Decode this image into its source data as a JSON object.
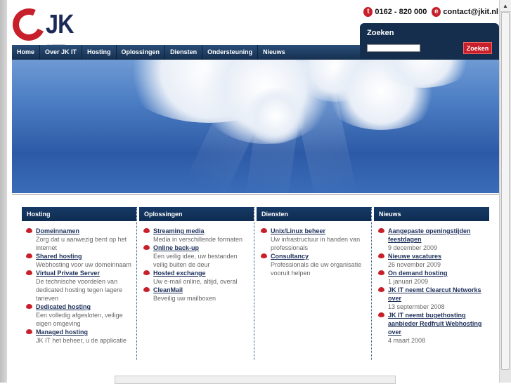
{
  "header": {
    "logo_text": "JK IT",
    "phone_icon": "t",
    "phone": "0162 - 820 000",
    "email_icon": "e",
    "email": "contact@jkit.nl"
  },
  "search": {
    "label": "Zoeken",
    "placeholder": "",
    "button": "Zoeken"
  },
  "nav": [
    "Home",
    "Over JK IT",
    "Hosting",
    "Oplossingen",
    "Diensten",
    "Ondersteuning",
    "Nieuws"
  ],
  "columns": [
    {
      "title": "Hosting",
      "items": [
        {
          "link": "Domeinnamen",
          "text": "Zorg dat u aanwezig bent op het internet"
        },
        {
          "link": "Shared hosting",
          "text": "Webhosting voor uw domeinnaam"
        },
        {
          "link": "Virtual Private Server",
          "text": "De technische voordelen van dedicated hosting tegen lagere tarieven"
        },
        {
          "link": "Dedicated hosting",
          "text": "Een volledig afgesloten, veilige eigen omgeving"
        },
        {
          "link": "Managed hosting",
          "text": "JK IT het beheer, u de applicatie"
        }
      ]
    },
    {
      "title": "Oplossingen",
      "items": [
        {
          "link": "Streaming media",
          "text": "Media in verschillende formaten"
        },
        {
          "link": "Online back-up",
          "text": "Een veilig idee, uw bestanden veilig buiten de deur"
        },
        {
          "link": "Hosted exchange",
          "text": "Uw e-mail online, altijd, overal"
        },
        {
          "link": "CleanMail",
          "text": "Beveilig uw mailboxen"
        }
      ]
    },
    {
      "title": "Diensten",
      "items": [
        {
          "link": "Unix/Linux beheer",
          "text": "Uw infrastructuur in handen van professionals"
        },
        {
          "link": "Consultancy",
          "text": "Professionals die uw organisatie vooruit helpen"
        }
      ]
    },
    {
      "title": "Nieuws",
      "items": [
        {
          "link": "Aangepaste openingstijden feestdagen",
          "text": "9 december 2009"
        },
        {
          "link": "Nieuwe vacatures",
          "text": "26 november 2009"
        },
        {
          "link": "On demand hosting",
          "text": "1 januari 2009"
        },
        {
          "link": "JK IT neemt Clearcut Networks over",
          "text": "13 septermber 2008"
        },
        {
          "link": "JK IT neemt bugethosting aanbieder Redfruit Webhosting over",
          "text": "4 maart 2008"
        }
      ]
    }
  ]
}
